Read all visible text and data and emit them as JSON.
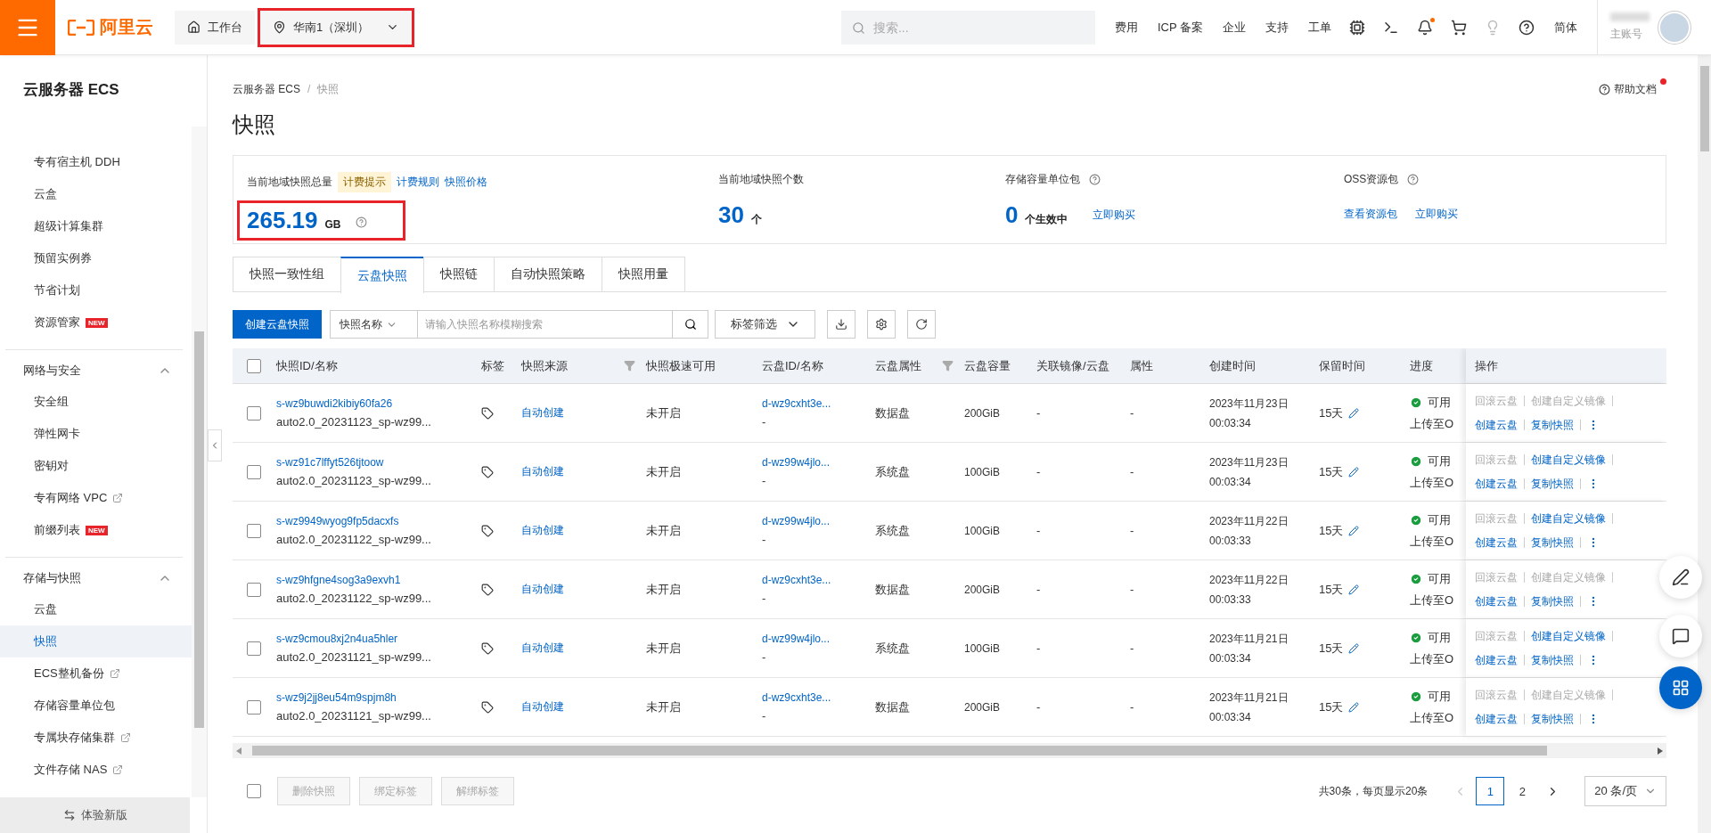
{
  "topbar": {
    "logo_text": "阿里云",
    "workbench": "工作台",
    "region": {
      "label": "华南1（深圳）",
      "highlighted": true
    },
    "search": {
      "placeholder": "搜索..."
    },
    "nav_links": [
      "费用",
      "ICP 备案",
      "企业",
      "支持",
      "工单"
    ],
    "language": "简体",
    "account": "主账号"
  },
  "sidebar": {
    "title": "云服务器 ECS",
    "sections": [
      {
        "items": [
          {
            "label": "专有宿主机 DDH",
            "selected": false,
            "external": false
          },
          {
            "label": "云盒",
            "selected": false,
            "external": false
          },
          {
            "label": "超级计算集群",
            "selected": false,
            "external": false
          },
          {
            "label": "预留实例券",
            "selected": false,
            "external": false
          },
          {
            "label": "节省计划",
            "selected": false,
            "external": false
          },
          {
            "label": "资源管家",
            "badge": "NEW",
            "selected": false,
            "external": false
          }
        ]
      },
      {
        "title": "网络与安全",
        "expanded": true,
        "items": [
          {
            "label": "安全组",
            "selected": false,
            "external": false
          },
          {
            "label": "弹性网卡",
            "selected": false,
            "external": false
          },
          {
            "label": "密钥对",
            "selected": false,
            "external": false
          },
          {
            "label": "专有网络 VPC",
            "selected": false,
            "external": true
          },
          {
            "label": "前缀列表",
            "badge": "NEW",
            "selected": false,
            "external": false
          }
        ]
      },
      {
        "title": "存储与快照",
        "expanded": true,
        "items": [
          {
            "label": "云盘",
            "selected": false,
            "external": false
          },
          {
            "label": "快照",
            "selected": true,
            "external": false
          },
          {
            "label": "ECS整机备份",
            "selected": false,
            "external": true
          },
          {
            "label": "存储容量单位包",
            "selected": false,
            "external": false
          },
          {
            "label": "专属块存储集群",
            "selected": false,
            "external": true
          },
          {
            "label": "文件存储 NAS",
            "selected": false,
            "external": true
          }
        ]
      }
    ],
    "footer_button": "体验新版"
  },
  "breadcrumb": [
    "云服务器 ECS",
    "快照"
  ],
  "breadcrumb_separator": "/",
  "help_link": "帮助文档",
  "page_title": "快照",
  "summary": [
    {
      "label": "当前地域快照总量",
      "tag": "计费提示",
      "header_links": [
        "计费规则",
        "快照价格"
      ],
      "value": "265.19",
      "unit": "GB",
      "value_help": true,
      "highlighted": true
    },
    {
      "label": "当前地域快照个数",
      "value": "30",
      "unit": "个"
    },
    {
      "label": "存储容量单位包",
      "label_help": true,
      "value": "0",
      "unit": "个生效中",
      "value_links": [
        "立即购买"
      ]
    },
    {
      "label": "OSS资源包",
      "label_help": true,
      "value_links": [
        "查看资源包",
        "立即购买"
      ]
    }
  ],
  "tabs": [
    {
      "label": "快照一致性组",
      "selected": false
    },
    {
      "label": "云盘快照",
      "selected": true
    },
    {
      "label": "快照链",
      "selected": false
    },
    {
      "label": "自动快照策略",
      "selected": false
    },
    {
      "label": "快照用量",
      "selected": false
    }
  ],
  "toolbar": {
    "create_button": "创建云盘快照",
    "field_select": "快照名称",
    "search_placeholder": "请输入快照名称模糊搜索",
    "tag_filter": "标签筛选"
  },
  "table": {
    "select_all": {
      "checked": false
    },
    "columns": [
      {
        "label": "快照ID/名称",
        "filter": false
      },
      {
        "label": "标签",
        "filter": false
      },
      {
        "label": "快照来源",
        "filter": true
      },
      {
        "label": "快照极速可用",
        "filter": false
      },
      {
        "label": "云盘ID/名称",
        "filter": false
      },
      {
        "label": "云盘属性",
        "filter": true
      },
      {
        "label": "云盘容量",
        "filter": false
      },
      {
        "label": "关联镜像/云盘",
        "filter": false
      },
      {
        "label": "属性",
        "filter": false
      },
      {
        "label": "创建时间",
        "filter": false
      },
      {
        "label": "保留时间",
        "filter": false
      },
      {
        "label": "进度",
        "filter": false
      },
      {
        "label": "操作",
        "filter": false
      }
    ],
    "rows": [
      {
        "checked": false,
        "id": "s-wz9buwdi2kibiy60fa26",
        "name": "auto2.0_20231123_sp-wz99...",
        "source": "自动创建",
        "fast": "未开启",
        "disk_id": "d-wz9cxht3e...",
        "disk_name": "-",
        "disk_type": "数据盘",
        "capacity": "200GiB",
        "image": "-",
        "attr": "-",
        "created_date": "2023年11月23日",
        "created_time": "00:03:34",
        "retention": "15天",
        "status": "可用",
        "upload": "上传至O",
        "actions": [
          {
            "label": "回滚云盘",
            "enabled": false
          },
          {
            "label": "创建自定义镜像",
            "enabled": false
          },
          {
            "label": "创建云盘",
            "enabled": true
          },
          {
            "label": "复制快照",
            "enabled": true
          }
        ]
      },
      {
        "checked": false,
        "id": "s-wz91c7lffyt526tjtoow",
        "name": "auto2.0_20231123_sp-wz99...",
        "source": "自动创建",
        "fast": "未开启",
        "disk_id": "d-wz99w4jlo...",
        "disk_name": "-",
        "disk_type": "系统盘",
        "capacity": "100GiB",
        "image": "-",
        "attr": "-",
        "created_date": "2023年11月23日",
        "created_time": "00:03:34",
        "retention": "15天",
        "status": "可用",
        "upload": "上传至O",
        "actions": [
          {
            "label": "回滚云盘",
            "enabled": false
          },
          {
            "label": "创建自定义镜像",
            "enabled": true
          },
          {
            "label": "创建云盘",
            "enabled": true
          },
          {
            "label": "复制快照",
            "enabled": true
          }
        ]
      },
      {
        "checked": false,
        "id": "s-wz9949wyog9fp5dacxfs",
        "name": "auto2.0_20231122_sp-wz99...",
        "source": "自动创建",
        "fast": "未开启",
        "disk_id": "d-wz99w4jlo...",
        "disk_name": "-",
        "disk_type": "系统盘",
        "capacity": "100GiB",
        "image": "-",
        "attr": "-",
        "created_date": "2023年11月22日",
        "created_time": "00:03:33",
        "retention": "15天",
        "status": "可用",
        "upload": "上传至O",
        "actions": [
          {
            "label": "回滚云盘",
            "enabled": false
          },
          {
            "label": "创建自定义镜像",
            "enabled": true
          },
          {
            "label": "创建云盘",
            "enabled": true
          },
          {
            "label": "复制快照",
            "enabled": true
          }
        ]
      },
      {
        "checked": false,
        "id": "s-wz9hfgne4sog3a9exvh1",
        "name": "auto2.0_20231122_sp-wz99...",
        "source": "自动创建",
        "fast": "未开启",
        "disk_id": "d-wz9cxht3e...",
        "disk_name": "-",
        "disk_type": "数据盘",
        "capacity": "200GiB",
        "image": "-",
        "attr": "-",
        "created_date": "2023年11月22日",
        "created_time": "00:03:33",
        "retention": "15天",
        "status": "可用",
        "upload": "上传至O",
        "actions": [
          {
            "label": "回滚云盘",
            "enabled": false
          },
          {
            "label": "创建自定义镜像",
            "enabled": false
          },
          {
            "label": "创建云盘",
            "enabled": true
          },
          {
            "label": "复制快照",
            "enabled": true
          }
        ]
      },
      {
        "checked": false,
        "id": "s-wz9cmou8xj2n4ua5hler",
        "name": "auto2.0_20231121_sp-wz99...",
        "source": "自动创建",
        "fast": "未开启",
        "disk_id": "d-wz99w4jlo...",
        "disk_name": "-",
        "disk_type": "系统盘",
        "capacity": "100GiB",
        "image": "-",
        "attr": "-",
        "created_date": "2023年11月21日",
        "created_time": "00:03:34",
        "retention": "15天",
        "status": "可用",
        "upload": "上传至O",
        "actions": [
          {
            "label": "回滚云盘",
            "enabled": false
          },
          {
            "label": "创建自定义镜像",
            "enabled": true
          },
          {
            "label": "创建云盘",
            "enabled": true
          },
          {
            "label": "复制快照",
            "enabled": true
          }
        ]
      },
      {
        "checked": false,
        "id": "s-wz9j2jj8eu54m9spjm8h",
        "name": "auto2.0_20231121_sp-wz99...",
        "source": "自动创建",
        "fast": "未开启",
        "disk_id": "d-wz9cxht3e...",
        "disk_name": "-",
        "disk_type": "数据盘",
        "capacity": "200GiB",
        "image": "-",
        "attr": "-",
        "created_date": "2023年11月21日",
        "created_time": "00:03:34",
        "retention": "15天",
        "status": "可用",
        "upload": "上传至O",
        "actions": [
          {
            "label": "回滚云盘",
            "enabled": false
          },
          {
            "label": "创建自定义镜像",
            "enabled": false
          },
          {
            "label": "创建云盘",
            "enabled": true
          },
          {
            "label": "复制快照",
            "enabled": true
          }
        ]
      }
    ]
  },
  "footer": {
    "select_all": {
      "checked": false
    },
    "batch_buttons": [
      {
        "label": "删除快照",
        "disabled": true
      },
      {
        "label": "绑定标签",
        "disabled": true
      },
      {
        "label": "解绑标签",
        "disabled": true
      }
    ],
    "total": "共30条，每页显示20条",
    "pages": [
      {
        "label": "1",
        "selected": true
      },
      {
        "label": "2",
        "selected": false
      }
    ],
    "page_size": "20 条/页"
  }
}
